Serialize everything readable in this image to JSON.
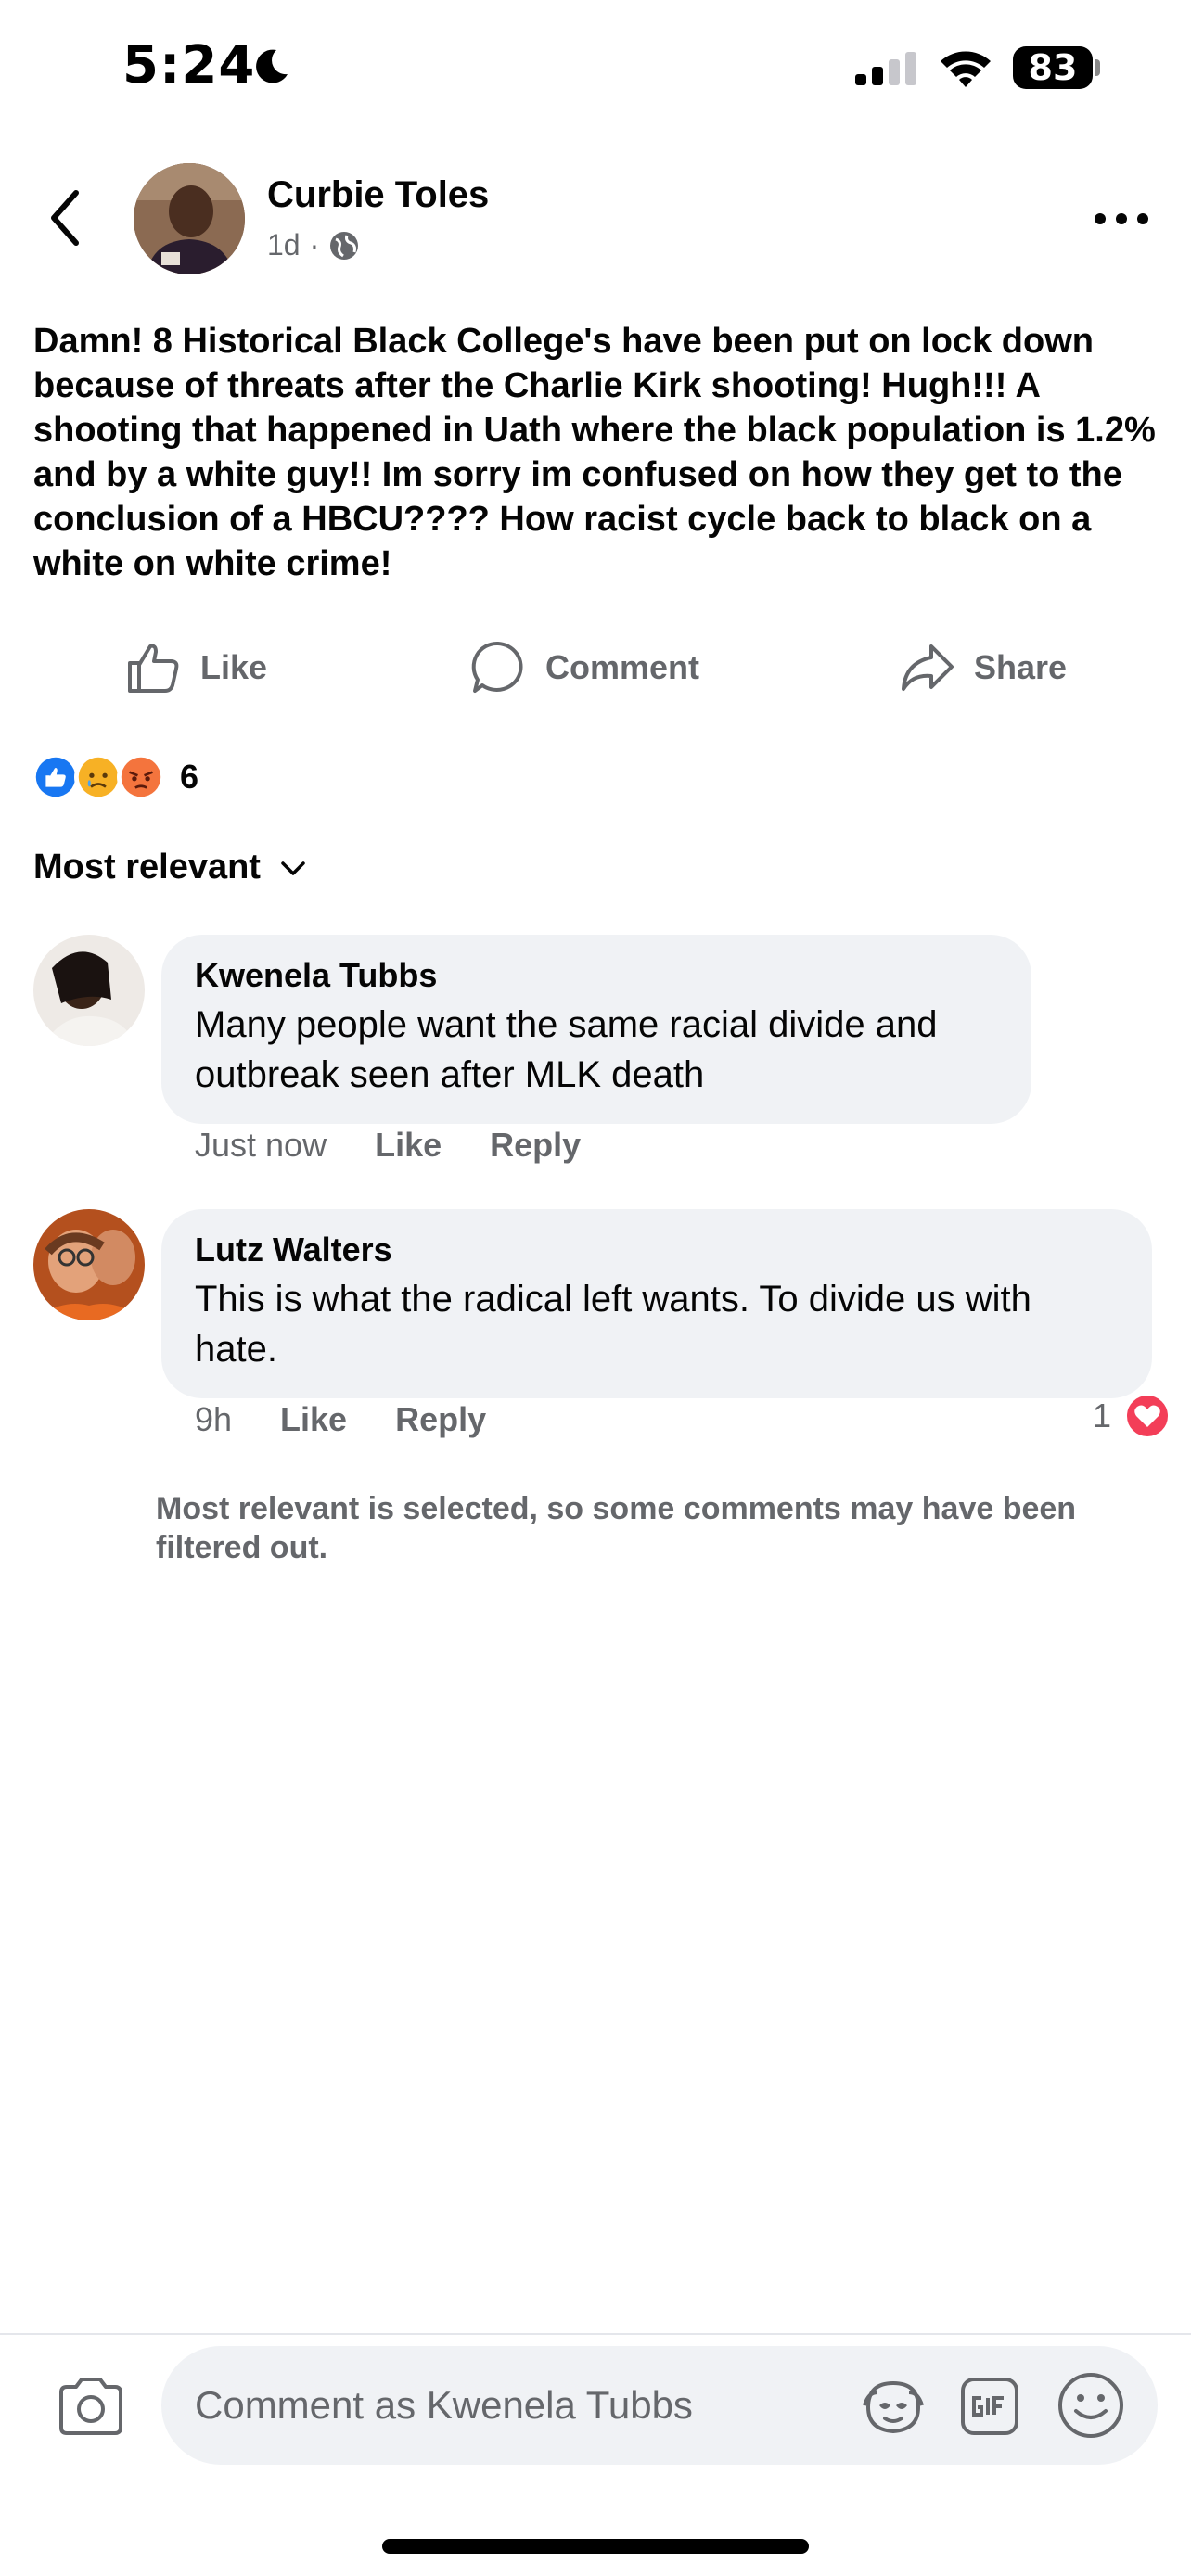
{
  "status_bar": {
    "time": "5:24",
    "battery": "83"
  },
  "post": {
    "author": "Curbie Toles",
    "time": "1d",
    "separator": "·",
    "text": "Damn! 8 Historical Black College's have been put on lock down because of threats after the Charlie Kirk shooting! Hugh!!! A shooting that happened in Uath where the black population is 1.2% and by a white guy!! Im sorry im confused on how they get to the conclusion of a HBCU???? How racist cycle back to black on a white on white crime!"
  },
  "actions": {
    "like": "Like",
    "comment": "Comment",
    "share": "Share"
  },
  "reactions": {
    "types": [
      "like",
      "sad",
      "angry"
    ],
    "count": "6"
  },
  "sort": {
    "label": "Most relevant"
  },
  "comments": [
    {
      "author": "Kwenela Tubbs",
      "text": "Many people want the same racial divide and outbreak seen after MLK death",
      "time": "Just now",
      "like": "Like",
      "reply": "Reply"
    },
    {
      "author": "Lutz Walters",
      "text": "This is what the radical left wants. To divide us with hate.",
      "time": "9h",
      "like": "Like",
      "reply": "Reply",
      "reaction_count": "1",
      "reaction": "love"
    }
  ],
  "filter_note": "Most relevant is selected, so some comments may have been filtered out.",
  "composer": {
    "placeholder": "Comment as Kwenela Tubbs"
  },
  "colors": {
    "primary": "#1877f2",
    "secondary_text": "#65676b",
    "bubble": "#f0f2f5",
    "love": "#f33e58"
  }
}
